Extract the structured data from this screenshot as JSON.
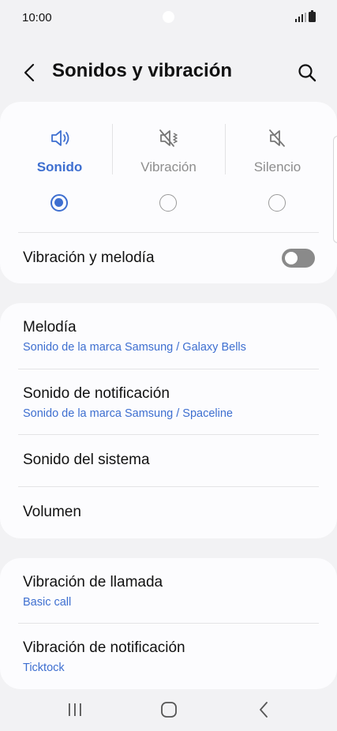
{
  "status_bar": {
    "time": "10:00"
  },
  "header": {
    "title": "Sonidos y vibración"
  },
  "sound_mode": {
    "options": [
      {
        "label": "Sonido",
        "icon": "speaker-icon",
        "selected": true
      },
      {
        "label": "Vibración",
        "icon": "vibrate-icon",
        "selected": false
      },
      {
        "label": "Silencio",
        "icon": "mute-icon",
        "selected": false
      }
    ],
    "vibrate_with_ringtone": {
      "label": "Vibración y melodía",
      "enabled": false
    }
  },
  "sound_settings": [
    {
      "title": "Melodía",
      "subtitle": "Sonido de la marca Samsung / Galaxy Bells"
    },
    {
      "title": "Sonido de notificación",
      "subtitle": "Sonido de la marca Samsung / Spaceline"
    },
    {
      "title": "Sonido del sistema"
    },
    {
      "title": "Volumen"
    }
  ],
  "vibration_settings": [
    {
      "title": "Vibración de llamada",
      "subtitle": "Basic call"
    },
    {
      "title": "Vibración de notificación",
      "subtitle": "Ticktock"
    }
  ],
  "colors": {
    "accent": "#3e6fd0",
    "background": "#f2f2f4",
    "card": "#fcfcfe"
  },
  "nav_bar": {
    "icons": [
      "recent-apps-icon",
      "home-icon",
      "back-icon"
    ]
  }
}
